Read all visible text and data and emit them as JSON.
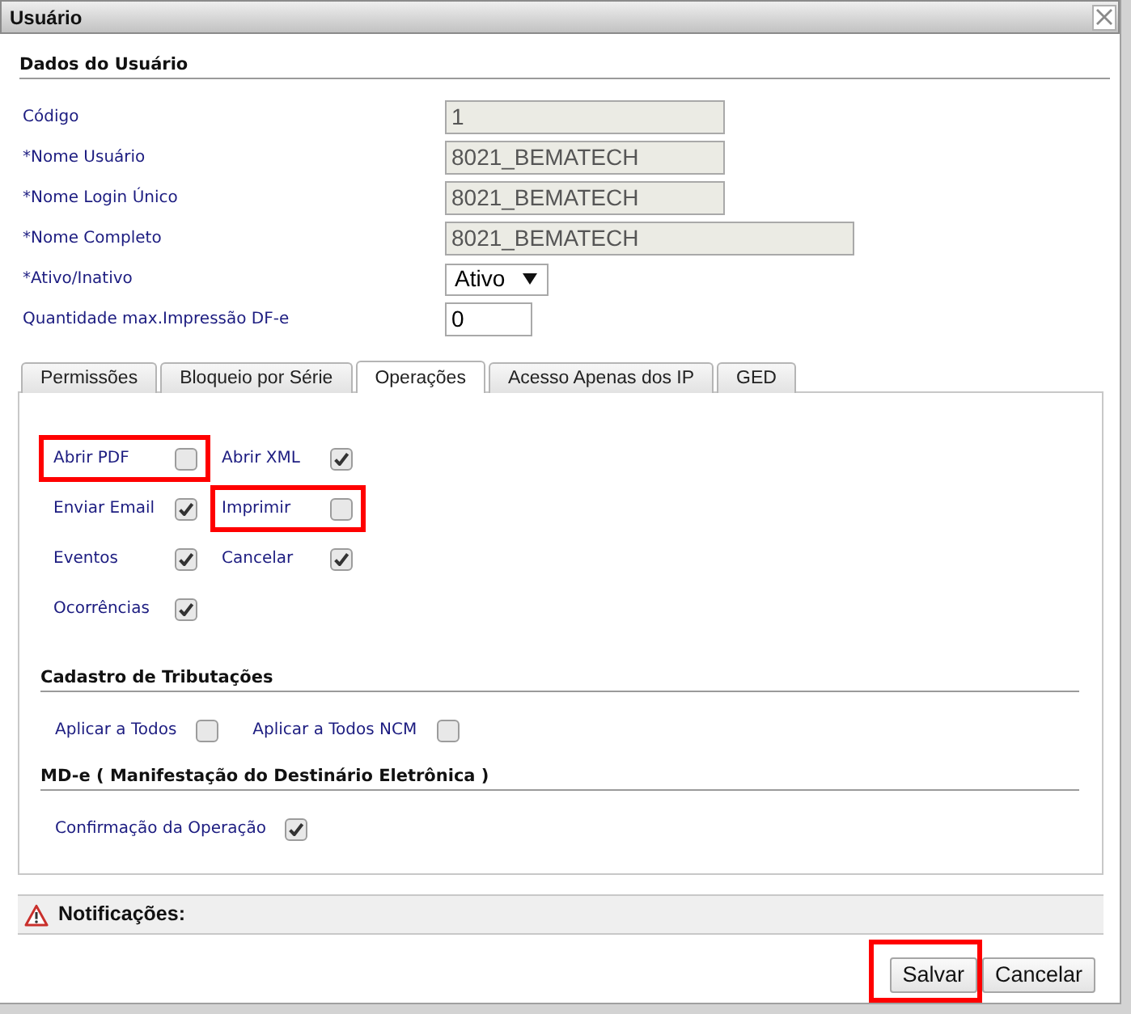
{
  "window": {
    "title": "Usuário"
  },
  "user_data": {
    "title": "Dados do Usuário",
    "fields": [
      {
        "label": "Código",
        "kind": "text",
        "value": "1",
        "disabled": true
      },
      {
        "label": "*Nome Usuário",
        "kind": "text",
        "value": "8021_BEMATECH",
        "disabled": true
      },
      {
        "label": "*Nome Login Único",
        "kind": "text",
        "value": "8021_BEMATECH",
        "disabled": true
      },
      {
        "label": "*Nome Completo",
        "kind": "text",
        "value": "8021_BEMATECH",
        "disabled": true
      },
      {
        "label": "*Ativo/Inativo",
        "kind": "select",
        "value": "Ativo"
      },
      {
        "label": "Quantidade max.Impressão DF-e",
        "kind": "text",
        "value": "0",
        "disabled": false
      }
    ]
  },
  "tabs": [
    {
      "label": "Permissões",
      "selected": false
    },
    {
      "label": "Bloqueio por Série",
      "selected": false
    },
    {
      "label": "Operações",
      "selected": true
    },
    {
      "label": "Acesso Apenas dos IP",
      "selected": false
    },
    {
      "label": "GED",
      "selected": false
    }
  ],
  "operations": [
    {
      "label": "Abrir PDF",
      "checked": false,
      "highlighted": true
    },
    {
      "label": "Abrir XML",
      "checked": true,
      "highlighted": false
    },
    {
      "label": "Enviar Email",
      "checked": true,
      "highlighted": false
    },
    {
      "label": "Imprimir",
      "checked": false,
      "highlighted": true
    },
    {
      "label": "Eventos",
      "checked": true,
      "highlighted": false
    },
    {
      "label": "Cancelar",
      "checked": true,
      "highlighted": false
    },
    {
      "label": "Ocorrências",
      "checked": true,
      "highlighted": false
    }
  ],
  "sections": [
    {
      "title": "Cadastro de Tributações",
      "options": [
        {
          "label": "Aplicar a Todos",
          "checked": false
        },
        {
          "label": "Aplicar a Todos NCM",
          "checked": false
        }
      ]
    },
    {
      "title": "MD-e ( Manifestação do Destinário Eletrônica )",
      "options": [
        {
          "label": "Confirmação da Operação",
          "checked": true
        }
      ]
    }
  ],
  "notifications": {
    "label": "Notificações:"
  },
  "buttons": [
    {
      "label": "Salvar",
      "highlighted": true
    },
    {
      "label": "Cancelar",
      "highlighted": false
    }
  ]
}
